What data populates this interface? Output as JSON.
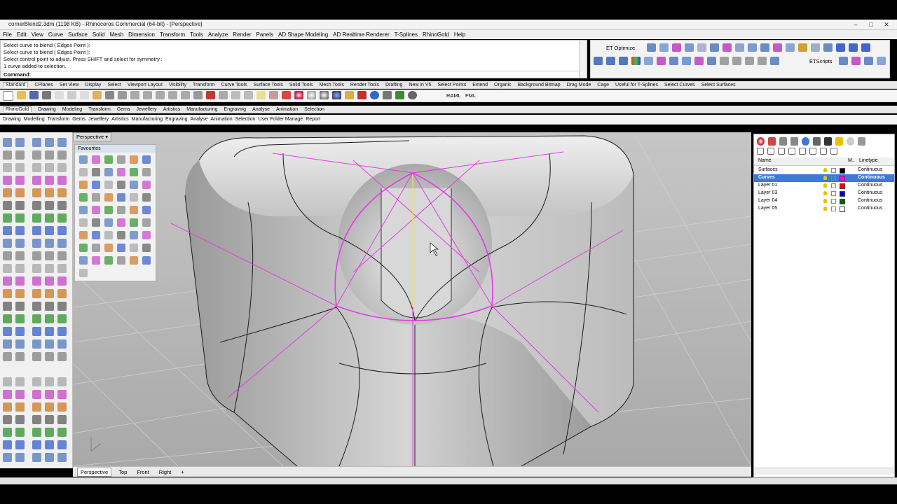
{
  "window": {
    "title": "cornerBlend2.3dm (1198 KB) - Rhinoceros Commercial (64-bit) - [Perspective]"
  },
  "menu": [
    "File",
    "Edit",
    "View",
    "Curve",
    "Surface",
    "Solid",
    "Mesh",
    "Dimension",
    "Transform",
    "Tools",
    "Analyze",
    "Render",
    "Panels",
    "AD Shape Modeling",
    "AD Realtime Renderer",
    "T-Splines",
    "RhinoGold",
    "Help"
  ],
  "command_history": [
    "Select curve to blend ( Edges  Point ):",
    "Select curve to blend ( Edges  Point ):",
    "Select control point to adjust. Press SHIFT and select for symmetry.:",
    "1 curve added to selection."
  ],
  "command_prompt": "Command:",
  "et_panel": {
    "optimize_label": "ET Optimize",
    "scripts_label": "ETScripts"
  },
  "toolbar_tabs": [
    "Standard",
    "CPlanes",
    "Set View",
    "Display",
    "Select",
    "Viewport Layout",
    "Visibility",
    "Transform",
    "Curve Tools",
    "Surface Tools",
    "Solid Tools",
    "Mesh Tools",
    "Render Tools",
    "Drafting",
    "New in V5",
    "Select Points",
    "Extend",
    "Organic",
    "Background Bitmap",
    "Drag Mode",
    "Cage",
    "Useful for T-Splines",
    "Select Curves",
    "Select Surfaces"
  ],
  "standard_extra": [
    "RAML",
    "FML"
  ],
  "rhinogold_tabs": [
    "RhinoGold",
    "Drawing",
    "Modeling",
    "Transform",
    "Gems",
    "Jewellery",
    "Artistics",
    "Manufacturing",
    "Engraving",
    "Analyse",
    "Animation",
    "Selection"
  ],
  "rhinogold_menu": [
    "Drawing",
    "Modelling",
    "Transform",
    "Gems",
    "Jewellery",
    "Artistics",
    "Manufacturing",
    "Engraving",
    "Analyse",
    "Animation",
    "Selection",
    "User Folder Manage",
    "Report"
  ],
  "viewport": {
    "title": "Perspective"
  },
  "favourites": {
    "title": "Favourites"
  },
  "viewport_tabs": [
    "Perspective",
    "Top",
    "Front",
    "Right"
  ],
  "layers": {
    "columns": {
      "name": "Name",
      "material": "M..",
      "linetype": "Linetype"
    },
    "rows": [
      {
        "name": "Surfaces",
        "color": "#000000",
        "linetype": "Continuous",
        "selected": false
      },
      {
        "name": "Curves",
        "color": "#ff00ff",
        "linetype": "Continuous",
        "selected": true
      },
      {
        "name": "Layer 01",
        "color": "#ff0000",
        "linetype": "Continuous",
        "selected": false
      },
      {
        "name": "Layer 03",
        "color": "#0000cc",
        "linetype": "Continuous",
        "selected": false
      },
      {
        "name": "Layer 04",
        "color": "#006600",
        "linetype": "Continuous",
        "selected": false
      },
      {
        "name": "Layer 05",
        "color": "#ffffff",
        "linetype": "Continuous",
        "selected": false
      }
    ]
  },
  "colors": {
    "curve": "#e23be2",
    "accent": "#3a7bd5"
  }
}
